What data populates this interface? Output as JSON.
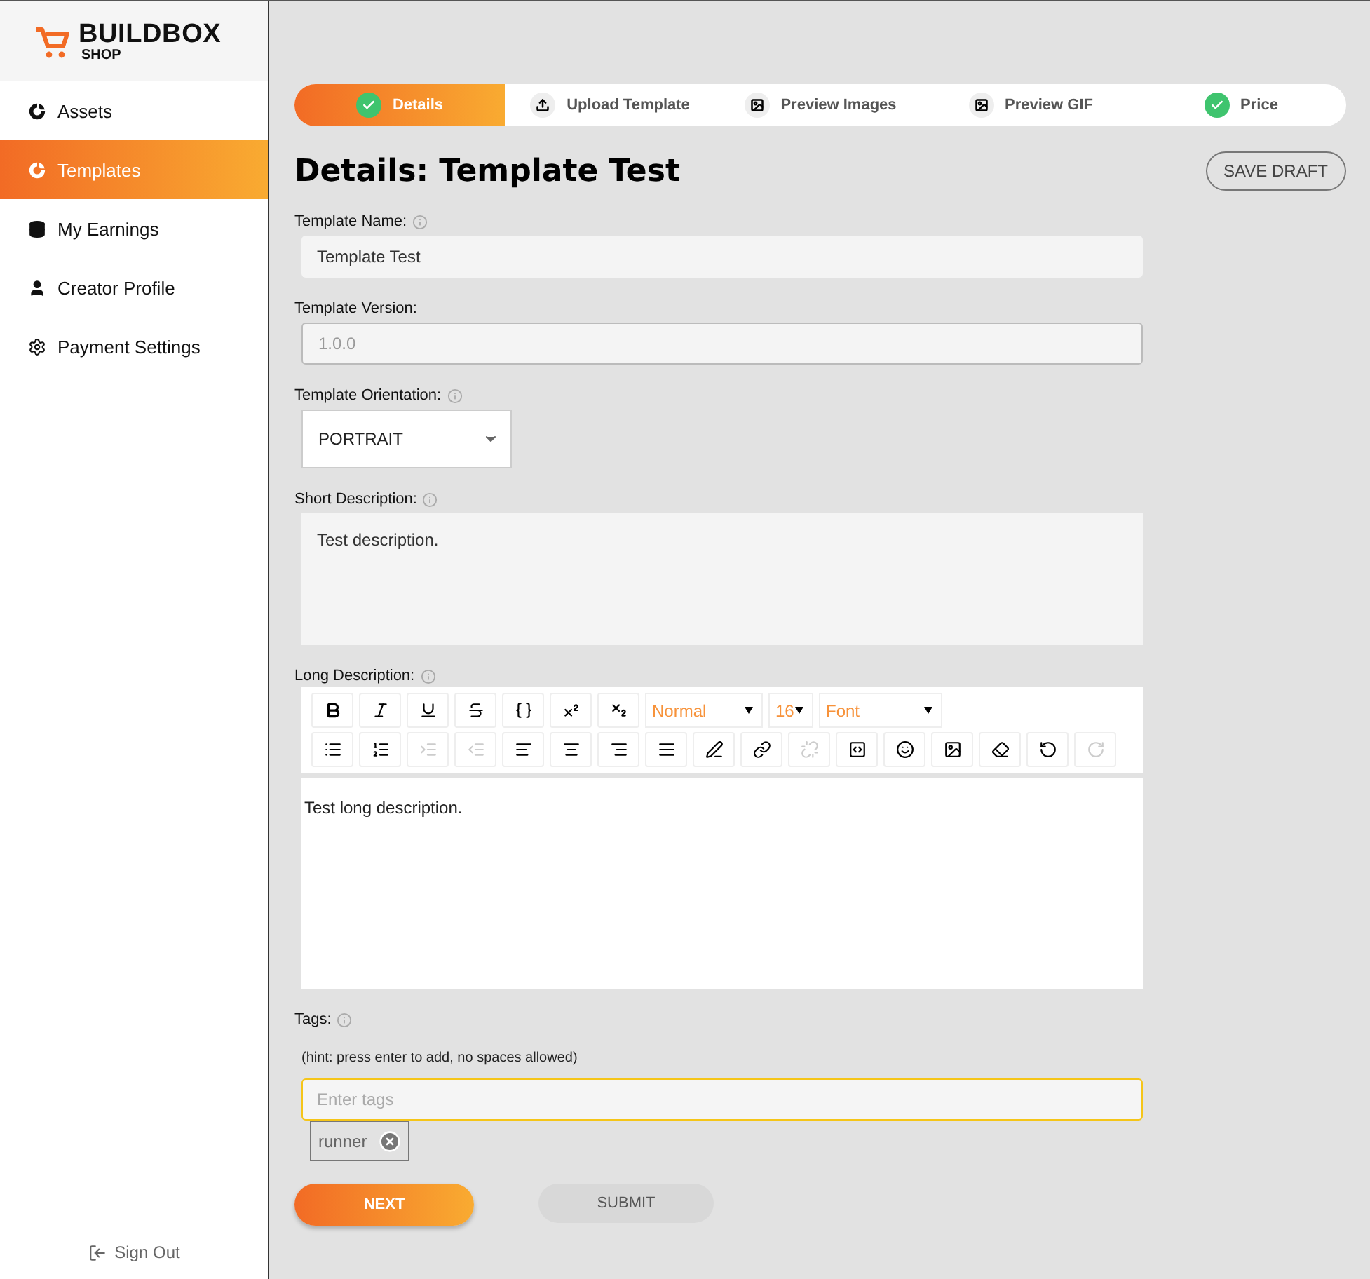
{
  "logo": {
    "name": "BUILDBOX",
    "sub": "SHOP"
  },
  "sidebar": {
    "items": [
      {
        "label": "Assets",
        "selected": false
      },
      {
        "label": "Templates",
        "selected": true
      },
      {
        "label": "My Earnings",
        "selected": false
      },
      {
        "label": "Creator Profile",
        "selected": false
      },
      {
        "label": "Payment Settings",
        "selected": false
      }
    ],
    "sign_out": "Sign Out"
  },
  "steps": [
    {
      "label": "Details",
      "kind": "done",
      "selected": true
    },
    {
      "label": "Upload Template",
      "kind": "upload",
      "selected": false
    },
    {
      "label": "Preview Images",
      "kind": "image",
      "selected": false
    },
    {
      "label": "Preview GIF",
      "kind": "image",
      "selected": false
    },
    {
      "label": "Price",
      "kind": "done",
      "selected": false
    }
  ],
  "title": "Details: Template Test",
  "save_draft": "SAVE DRAFT",
  "template_name": {
    "label": "Template Name:",
    "value": "Template Test"
  },
  "template_version": {
    "label": "Template Version:",
    "value": "1.0.0",
    "disabled": true
  },
  "template_orientation": {
    "label": "Template Orientation:",
    "value": "PORTRAIT"
  },
  "short_description": {
    "label": "Short Description:",
    "value": "Test description."
  },
  "long_description": {
    "label": "Long Description:",
    "value": "Test long description.",
    "toolbar_row_1": [
      {
        "kind": "bold",
        "disabled": false
      },
      {
        "kind": "italic",
        "disabled": false
      },
      {
        "kind": "underline",
        "disabled": false
      },
      {
        "kind": "strike",
        "disabled": false
      },
      {
        "kind": "code",
        "disabled": false
      },
      {
        "kind": "superscript",
        "disabled": false
      },
      {
        "kind": "subscript",
        "disabled": false
      }
    ],
    "dropdowns": [
      {
        "value": "Normal"
      },
      {
        "value": "16"
      },
      {
        "value": "Font"
      }
    ],
    "toolbar_row_2": [
      {
        "kind": "bullets",
        "disabled": false
      },
      {
        "kind": "numbers",
        "disabled": false
      },
      {
        "kind": "indent",
        "disabled": true
      },
      {
        "kind": "outdent",
        "disabled": true
      },
      {
        "kind": "left",
        "disabled": false
      },
      {
        "kind": "center",
        "disabled": false
      },
      {
        "kind": "right",
        "disabled": false
      },
      {
        "kind": "justify",
        "disabled": false
      },
      {
        "kind": "pen",
        "disabled": false
      },
      {
        "kind": "link",
        "disabled": false
      },
      {
        "kind": "unlink",
        "disabled": true
      },
      {
        "kind": "embed",
        "disabled": false
      },
      {
        "kind": "emoji",
        "disabled": false
      },
      {
        "kind": "image",
        "disabled": false
      },
      {
        "kind": "eraser",
        "disabled": false
      },
      {
        "kind": "undo",
        "disabled": false
      },
      {
        "kind": "redo",
        "disabled": true
      }
    ]
  },
  "tags": {
    "label": "Tags:",
    "hint": "(hint: press enter to add, no spaces allowed)",
    "placeholder": "Enter tags",
    "items": [
      "runner"
    ]
  },
  "buttons": {
    "next": "NEXT",
    "submit": "SUBMIT"
  }
}
